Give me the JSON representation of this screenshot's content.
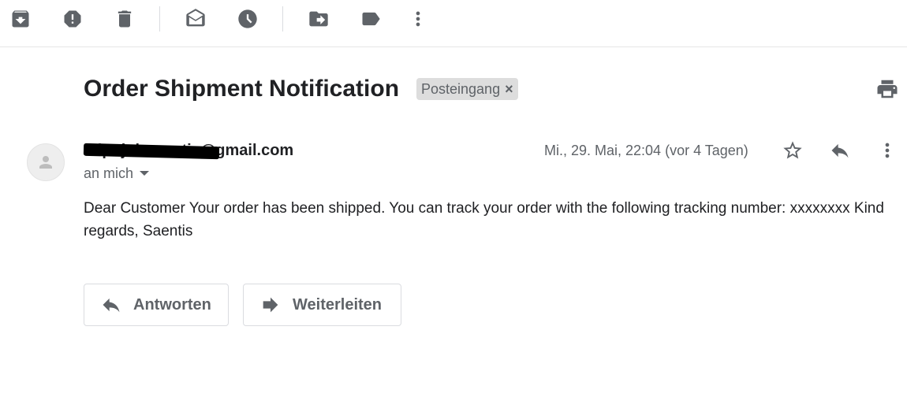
{
  "toolbar": {
    "icons": [
      "archive-icon",
      "report-spam-icon",
      "delete-icon",
      "mark-unread-icon",
      "snooze-icon",
      "move-to-icon",
      "label-icon",
      "more-vert-icon"
    ]
  },
  "email": {
    "subject": "Order Shipment Notification",
    "label_chip": "Posteingang",
    "label_chip_close": "×",
    "sender": "mipojuhossntis@gmail.com",
    "to": "an mich",
    "date": "Mi., 29. Mai, 22:04 (vor 4 Tagen)",
    "body": "Dear Customer Your order has been shipped. You can track your order with the following tracking number: xxxxxxxx Kind regards, Saentis"
  },
  "actions": {
    "reply_label": "Antworten",
    "forward_label": "Weiterleiten"
  },
  "colors": {
    "icon_gray": "#5f6368",
    "text_dark": "#202124",
    "chip_bg": "#dddddd",
    "border": "#dadce0"
  }
}
